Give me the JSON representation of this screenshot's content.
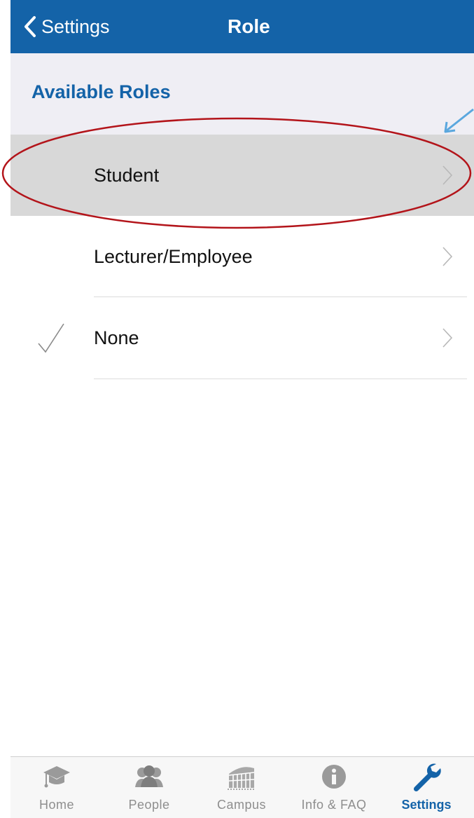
{
  "nav": {
    "back_label": "Settings",
    "title": "Role"
  },
  "section": {
    "title": "Available Roles"
  },
  "roles": [
    {
      "label": "Student",
      "selected_highlight": true,
      "checked": false
    },
    {
      "label": "Lecturer/Employee",
      "selected_highlight": false,
      "checked": false
    },
    {
      "label": "None",
      "selected_highlight": false,
      "checked": true
    }
  ],
  "tabs": [
    {
      "label": "Home",
      "icon": "graduation-cap-icon",
      "active": false
    },
    {
      "label": "People",
      "icon": "people-icon",
      "active": false
    },
    {
      "label": "Campus",
      "icon": "colosseum-icon",
      "active": false
    },
    {
      "label": "Info & FAQ",
      "icon": "info-icon",
      "active": false
    },
    {
      "label": "Settings",
      "icon": "wrench-icon",
      "active": true
    }
  ],
  "colors": {
    "brand": "#1463a8",
    "annotation_ellipse": "#b3141a",
    "annotation_arrow": "#5aa7de"
  }
}
